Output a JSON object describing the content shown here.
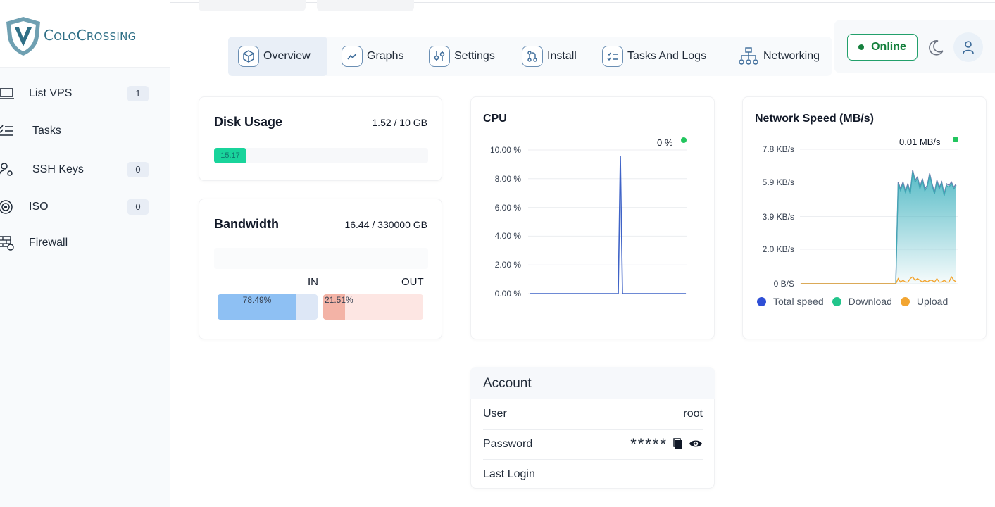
{
  "brand": {
    "logo_text_big1": "C",
    "logo_text_small1": "OLO",
    "logo_text_big2": "C",
    "logo_text_small2": "ROSSING",
    "accent": "#2f6f86"
  },
  "sidebar": {
    "items": [
      {
        "label": "List VPS",
        "badge": "1",
        "icon": "laptop-icon"
      },
      {
        "label": "Tasks",
        "badge": "",
        "icon": "tasks-icon"
      },
      {
        "label": "SSH Keys",
        "badge": "0",
        "icon": "key-user-icon"
      },
      {
        "label": "ISO",
        "badge": "0",
        "icon": "disc-icon"
      },
      {
        "label": "Firewall",
        "badge": "",
        "icon": "firewall-icon"
      }
    ]
  },
  "tabs": [
    {
      "label": "Overview",
      "icon": "box-icon",
      "active": true
    },
    {
      "label": "Graphs",
      "icon": "graph-icon",
      "active": false
    },
    {
      "label": "Settings",
      "icon": "sliders-icon",
      "active": false
    },
    {
      "label": "Install",
      "icon": "install-icon",
      "active": false
    },
    {
      "label": "Tasks And Logs",
      "icon": "checklist-icon",
      "active": false
    },
    {
      "label": "Networking",
      "icon": "network-icon",
      "active": false
    }
  ],
  "status": {
    "label": "Online",
    "color": "#15803d"
  },
  "disk": {
    "title": "Disk Usage",
    "usage": "1.52 / 10 GB",
    "bar_label": "15.17",
    "fraction": 0.152
  },
  "bandwidth": {
    "title": "Bandwidth",
    "usage": "16.44 / 330000 GB",
    "in_label": "IN",
    "out_label": "OUT",
    "in_pct_text": "78.49%",
    "out_pct_text": "21.51%",
    "in_fraction": 0.7849,
    "out_fraction": 0.2151
  },
  "cpu": {
    "title": "CPU",
    "current": "0 %",
    "ticks": [
      "10.00 %",
      "8.00 %",
      "6.00 %",
      "4.00 %",
      "2.00 %",
      "0.00 %"
    ]
  },
  "network": {
    "title": "Network Speed (MB/s)",
    "current": "0.01 MB/s",
    "ticks": [
      "7.8 KB/s",
      "5.9 KB/s",
      "3.9 KB/s",
      "2.0 KB/s",
      "0 B/S"
    ],
    "legend": [
      {
        "label": "Total speed",
        "color": "#2f4fd6"
      },
      {
        "label": "Download",
        "color": "#22c58b"
      },
      {
        "label": "Upload",
        "color": "#f2a531"
      }
    ]
  },
  "account": {
    "title": "Account",
    "rows": [
      {
        "key": "User",
        "value": "root"
      },
      {
        "key": "Password",
        "value": "*****"
      },
      {
        "key": "Last Login",
        "value": ""
      }
    ]
  },
  "chart_data": [
    {
      "type": "line",
      "title": "CPU",
      "ylim": [
        0,
        10
      ],
      "ytick_labels": [
        "0.00 %",
        "2.00 %",
        "4.00 %",
        "6.00 %",
        "8.00 %",
        "10.00 %"
      ],
      "series": [
        {
          "values": [
            0,
            0,
            0,
            0,
            0,
            0,
            0,
            0,
            0,
            0,
            0,
            0,
            0,
            0,
            0,
            0,
            0,
            0,
            0,
            0,
            0,
            0,
            0,
            0,
            0,
            0,
            0,
            0,
            0,
            0,
            0,
            0,
            0,
            0,
            0,
            0,
            0,
            0,
            0,
            0,
            0,
            0,
            0,
            9.6,
            0,
            0,
            0,
            0,
            0,
            0,
            0,
            0,
            0,
            0,
            0,
            0,
            0,
            0,
            0,
            0,
            0,
            0,
            0,
            0,
            0,
            0,
            0,
            0,
            0,
            0,
            0,
            0,
            0,
            0,
            0
          ]
        }
      ],
      "grid": true
    },
    {
      "type": "area",
      "title": "Network Speed (MB/s)",
      "ylim": [
        0,
        7.8
      ],
      "ytick_labels": [
        "0 B/S",
        "2.0 KB/s",
        "3.9 KB/s",
        "5.9 KB/s",
        "7.8 KB/s"
      ],
      "series": [
        {
          "name": "Total speed",
          "values": [
            0,
            0,
            0,
            0,
            0,
            0,
            0,
            0,
            0,
            0,
            0,
            0,
            0,
            0,
            0,
            0,
            0,
            0,
            0,
            0,
            0,
            0,
            0,
            0,
            0,
            0,
            0,
            0,
            0,
            0,
            0,
            0,
            0,
            0,
            0,
            0,
            0,
            0,
            0,
            0,
            5.9,
            5.5,
            5.9,
            5.4,
            5.8,
            5.3,
            6.6,
            6.0,
            6.2,
            5.6,
            6.1,
            5.5,
            5.7,
            6.4,
            5.8,
            5.3,
            6.0,
            5.6,
            5.9,
            5.2,
            5.8,
            5.7,
            5.9,
            5.6,
            5.8
          ]
        },
        {
          "name": "Download",
          "values": [
            0,
            0,
            0,
            0,
            0,
            0,
            0,
            0,
            0,
            0,
            0,
            0,
            0,
            0,
            0,
            0,
            0,
            0,
            0,
            0,
            0,
            0,
            0,
            0,
            0,
            0,
            0,
            0,
            0,
            0,
            0,
            0,
            0,
            0,
            0,
            0,
            0,
            0,
            0,
            0,
            5.8,
            5.4,
            5.8,
            5.3,
            5.7,
            5.2,
            6.5,
            5.9,
            6.1,
            5.5,
            6.0,
            5.4,
            5.6,
            6.3,
            5.7,
            5.2,
            5.9,
            5.5,
            5.8,
            5.1,
            5.7,
            5.6,
            5.8,
            5.5,
            5.7
          ]
        },
        {
          "name": "Upload",
          "values": [
            0,
            0,
            0,
            0,
            0,
            0,
            0,
            0,
            0,
            0,
            0,
            0,
            0,
            0,
            0,
            0,
            0,
            0,
            0,
            0,
            0,
            0,
            0,
            0,
            0,
            0,
            0,
            0,
            0,
            0,
            0,
            0,
            0,
            0,
            0,
            0,
            0,
            0,
            0,
            0,
            0.3,
            0.1,
            0.2,
            0.1,
            0.1,
            0.3,
            0.4,
            0.2,
            0.3,
            0.2,
            0.1,
            0.2,
            0.1,
            0.2,
            0.2,
            0.1,
            0.3,
            0.1,
            0.1,
            0.2,
            0.1,
            0.1,
            0.4,
            0.2,
            0.1
          ]
        }
      ],
      "legend_position": "bottom",
      "grid": true
    }
  ]
}
